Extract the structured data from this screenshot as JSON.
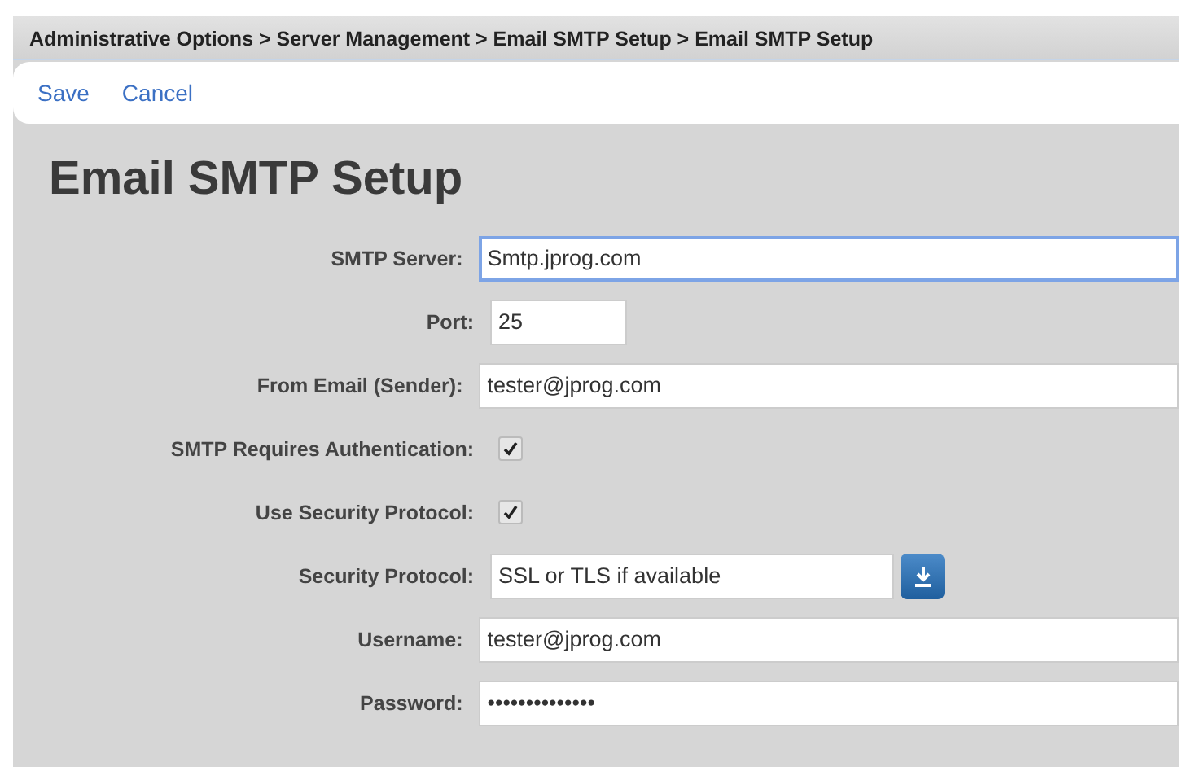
{
  "breadcrumb": "Administrative Options > Server Management > Email SMTP Setup > Email SMTP Setup",
  "toolbar": [
    "Save",
    "Cancel"
  ],
  "heading": "Email SMTP Setup",
  "fields": [
    {
      "label": "SMTP Server:",
      "kind": "text",
      "value": "Smtp.jprog.com",
      "focused": true
    },
    {
      "label": "Port:",
      "kind": "number",
      "value": "25",
      "focused": false
    },
    {
      "label": "From Email (Sender):",
      "kind": "text",
      "value": "tester@jprog.com",
      "focused": false
    },
    {
      "label": "SMTP Requires Authentication:",
      "kind": "checkbox",
      "checked": true
    },
    {
      "label": "Use Security Protocol:",
      "kind": "checkbox",
      "checked": true
    },
    {
      "label": "Security Protocol:",
      "kind": "select",
      "value": "SSL or TLS if available",
      "focused": false
    },
    {
      "label": "Username:",
      "kind": "text",
      "value": "tester@jprog.com",
      "focused": false
    },
    {
      "label": "Password:",
      "kind": "text",
      "value": "••••••••••••••",
      "focused": false
    }
  ]
}
